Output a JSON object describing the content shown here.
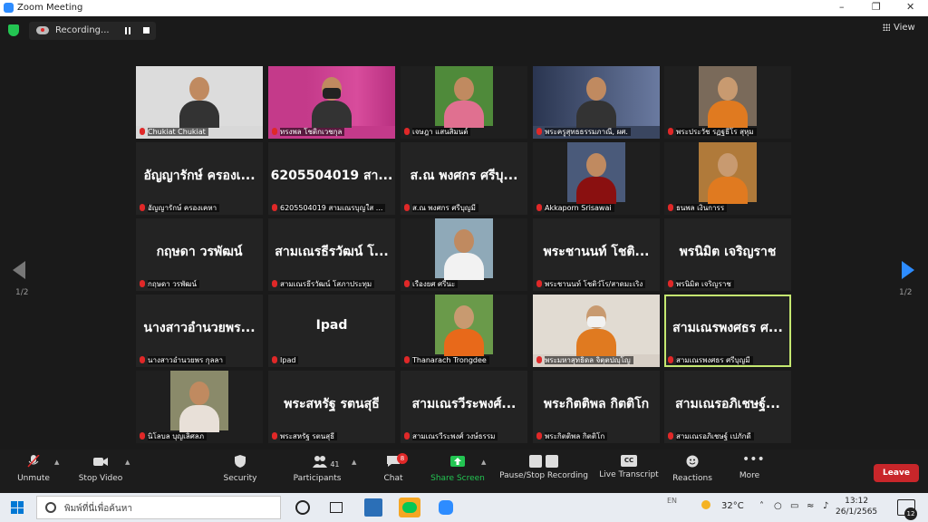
{
  "window": {
    "title": "Zoom Meeting"
  },
  "meeting": {
    "recording_label": "Recording...",
    "view_label": "View",
    "page_left": "1/2",
    "page_right": "1/2"
  },
  "tiles": [
    {
      "big": "",
      "name": "Chukiat Chukiat",
      "bg": "#d8d8d8",
      "photo": "person-suit"
    },
    {
      "big": "",
      "name": "ทรงพล โชติกเวชกุล",
      "bg": "#c43a8a",
      "photo": "person-mask"
    },
    {
      "big": "",
      "name": "เจษฎา แสนสิมนต์",
      "bg": "#1f1f1f",
      "photo": "person-pink"
    },
    {
      "big": "",
      "name": "พระครูสุทธธรรมภาณี, ผศ.",
      "bg": "#3a4660",
      "photo": "person-glasses"
    },
    {
      "big": "",
      "name": "พระประวัช รฏฐธีโร สุหุม",
      "bg": "#1f1f1f",
      "photo": "monk-orange"
    },
    {
      "big": "อัญญารักษ์ ครองเ...",
      "name": "อัญญารักษ์ ครองเคหา",
      "bg": "#232323",
      "photo": ""
    },
    {
      "big": "6205504019 สา...",
      "name": "6205504019 สามเณรบุญใส ...",
      "bg": "#232323",
      "photo": ""
    },
    {
      "big": "ส.ณ พงศกร ศรีบุ...",
      "name": "ส.ณ พงศกร ศรีบุญมี",
      "bg": "#232323",
      "photo": ""
    },
    {
      "big": "",
      "name": "Akkaporn Srisawai",
      "bg": "#1f1f1f",
      "photo": "person-red"
    },
    {
      "big": "",
      "name": "ธนพล เงินการร",
      "bg": "#1f1f1f",
      "photo": "monk-temple"
    },
    {
      "big": "กฤษดา วรพัฒน์",
      "name": "กฤษดา วรพัฒน์",
      "bg": "#232323",
      "photo": ""
    },
    {
      "big": "สามเณรธีรวัฒน์ โ...",
      "name": "สามเณรธีรวัฒน์ โสภาประทุม",
      "bg": "#232323",
      "photo": ""
    },
    {
      "big": "",
      "name": "เรืองยศ ศรีนะ",
      "bg": "#1f1f1f",
      "photo": "person-white"
    },
    {
      "big": "พระชานนท์ โชติ...",
      "name": "พระชานนท์ โชติวํโร/สาดมะเริง",
      "bg": "#232323",
      "photo": ""
    },
    {
      "big": "พรนิมิต เจริญราช",
      "name": "พรนิมิต เจริญราช",
      "bg": "#232323",
      "photo": ""
    },
    {
      "big": "นางสาวอำนวยพร...",
      "name": "นางสาวอำนวยพร กุลลา",
      "bg": "#232323",
      "photo": ""
    },
    {
      "big": "Ipad",
      "name": "Ipad",
      "bg": "#232323",
      "photo": ""
    },
    {
      "big": "",
      "name": "Thanarach Trongdee",
      "bg": "#1f1f1f",
      "photo": "monk-field"
    },
    {
      "big": "",
      "name": "พระมหาสุทธิดล จิตฺตปญฺโญ",
      "bg": "#d7cfc6",
      "photo": "monk-mask"
    },
    {
      "big": "สามเณรพงศธร ศ...",
      "name": "สามเณรพงศธร ศรีบุญมี",
      "bg": "#232323",
      "photo": "",
      "active": true
    },
    {
      "big": "",
      "name": "นิโลบล บุญเลิศลภ",
      "bg": "#1f1f1f",
      "photo": "person-outdoor"
    },
    {
      "big": "พระสหรัฐ รตนสุธี",
      "name": "พระสหรัฐ รตนสุธี",
      "bg": "#232323",
      "photo": ""
    },
    {
      "big": "สามเณรวีระพงศ์...",
      "name": "สามเณรวีระพงศ์ วงษ์ธรรม",
      "bg": "#232323",
      "photo": ""
    },
    {
      "big": "พระกิตติพล กิตติโก",
      "name": "พระกิตติพล กิตติโก",
      "bg": "#232323",
      "photo": ""
    },
    {
      "big": "สามเณรอภิเชษฐ์...",
      "name": "สามเณรอภิเชษฐ์ เปภักดี",
      "bg": "#232323",
      "photo": ""
    }
  ],
  "toolbar": {
    "unmute": "Unmute",
    "stop_video": "Stop Video",
    "security": "Security",
    "participants": "Participants",
    "participants_count": "41",
    "chat": "Chat",
    "chat_badge": "8",
    "share_screen": "Share Screen",
    "pause_stop_recording": "Pause/Stop Recording",
    "live_transcript": "Live Transcript",
    "cc_icon_text": "CC",
    "reactions": "Reactions",
    "more": "More",
    "leave": "Leave",
    "share_color": "#23c552"
  },
  "taskbar": {
    "search_placeholder": "พิมพ์ที่นี่เพื่อค้นหา",
    "lang": "EN",
    "temperature": "32°C",
    "time": "13:12",
    "date": "26/1/2565",
    "notification_count": "12"
  }
}
